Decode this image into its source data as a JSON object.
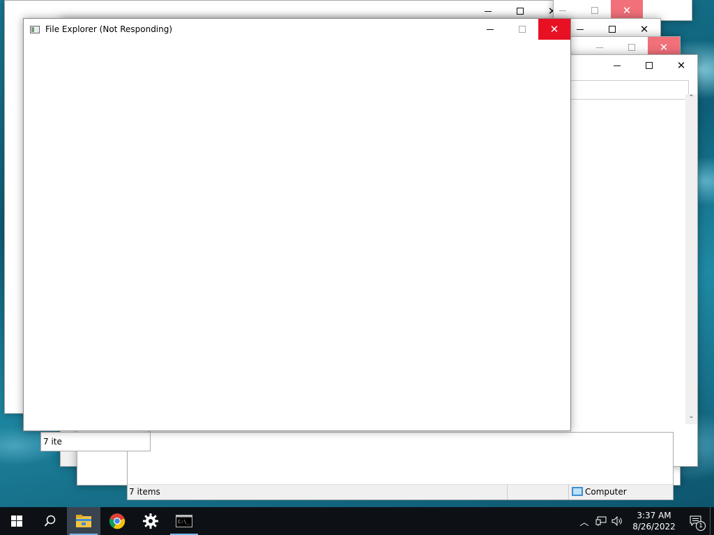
{
  "windows": {
    "back_top": {
      "title": ""
    },
    "main": {
      "title": "File Explorer (Not Responding)"
    },
    "status_left": {
      "items": "7 ite"
    },
    "status_bottom": {
      "items": "7 items",
      "location": "Computer"
    }
  },
  "taskbar": {
    "clock_time": "3:37 AM",
    "clock_date": "8/26/2022",
    "notification_count": "1",
    "apps": [
      "file-explorer",
      "chrome",
      "settings",
      "command-prompt"
    ]
  },
  "colors": {
    "close_red": "#e81123",
    "close_pink": "#f1707a",
    "taskbar_bg": "#0d1116",
    "accent": "#76b9ed"
  }
}
